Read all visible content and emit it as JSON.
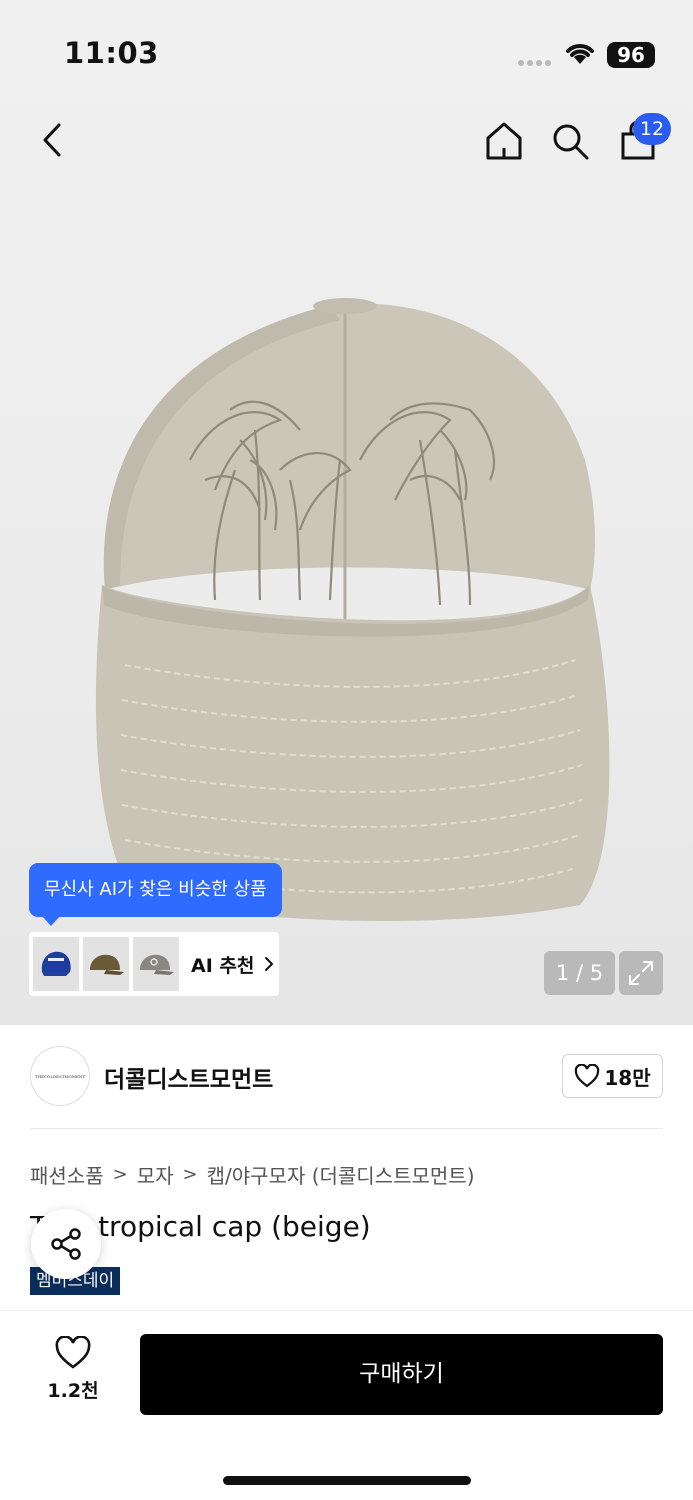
{
  "status_bar": {
    "time": "11:03",
    "battery": "96"
  },
  "header": {
    "cart_count": "12"
  },
  "ai_recommend": {
    "tooltip": "무신사 AI가 찾은 비슷한 상품",
    "label": "AI 추천"
  },
  "gallery": {
    "counter": "1 / 5"
  },
  "brand": {
    "name": "더콜디스트모먼트",
    "logo_text": "THECOLDESTMOMENT",
    "likes": "18만"
  },
  "breadcrumb": [
    "패션소품",
    "모자",
    "캡/야구모자 (더콜디스트모먼트)"
  ],
  "product": {
    "title": "TCM tropical cap (beige)",
    "tag": "멤버스데이"
  },
  "bottom_bar": {
    "like_count": "1.2천",
    "buy_label": "구매하기"
  },
  "colors": {
    "accent_blue": "#2f6bff",
    "cart_badge": "#2a5cf0",
    "tag_navy": "#0b2d5b",
    "cap_beige": "#c9c4b6"
  }
}
